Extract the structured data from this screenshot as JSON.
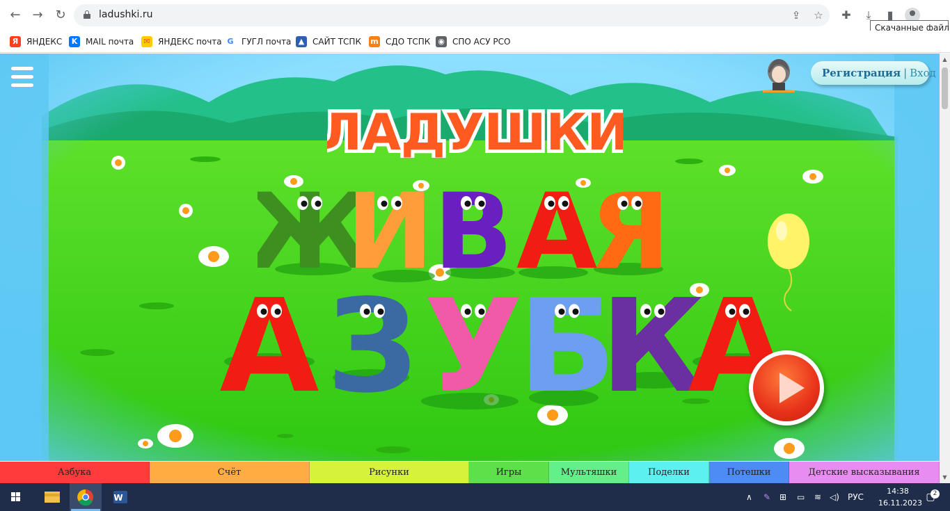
{
  "browser": {
    "url": "ladushki.ru",
    "tooltip": "Скачанные файлы",
    "bookmarks": [
      {
        "label": "ЯНДЕКС",
        "icon": "yandex-icon",
        "color": "#fc3f1d",
        "glyph": "Я"
      },
      {
        "label": "MAIL почта",
        "icon": "vk-icon",
        "color": "#0077ff",
        "glyph": "K"
      },
      {
        "label": "ЯНДЕКС почта",
        "icon": "mail-envelope-icon",
        "color": "#ffcc00",
        "glyph": "✉"
      },
      {
        "label": "ГУГЛ почта",
        "icon": "google-icon",
        "color": "#ffffff",
        "glyph": "G"
      },
      {
        "label": "САЙТ ТСПК",
        "icon": "tspk-icon",
        "color": "#2f5fb3",
        "glyph": "▲"
      },
      {
        "label": "СДО ТСПК",
        "icon": "moodle-icon",
        "color": "#f98012",
        "glyph": "m"
      },
      {
        "label": "СПО АСУ РСО",
        "icon": "globe-icon",
        "color": "#5f6368",
        "glyph": "◉"
      }
    ]
  },
  "page": {
    "auth": {
      "register": "Регистрация",
      "separator": "|",
      "login": "Вход"
    },
    "logo": "ЛАДУШКИ",
    "title_line1": [
      {
        "ch": "Ж",
        "color": "#3d8f1f"
      },
      {
        "ch": "И",
        "color": "#ff9d3b"
      },
      {
        "ch": "В",
        "color": "#6a1fbf"
      },
      {
        "ch": "А",
        "color": "#f21d12"
      },
      {
        "ch": "Я",
        "color": "#ff6a12"
      }
    ],
    "title_line2": [
      {
        "ch": "А",
        "color": "#f21d12"
      },
      {
        "ch": "З",
        "color": "#3b6aa3"
      },
      {
        "ch": "У",
        "color": "#f05aa8"
      },
      {
        "ch": "Б",
        "color": "#6d9ff0"
      },
      {
        "ch": "К",
        "color": "#6a2fa0"
      },
      {
        "ch": "А",
        "color": "#f21d12"
      }
    ],
    "colors": {
      "sky": "#5ec8f3",
      "grass": "#3ccf1c",
      "hills": "#1fbf7a",
      "balloon": "#fff36a"
    }
  },
  "categories": [
    {
      "label": "Азбука",
      "color": "#ff3b3b",
      "width": 215
    },
    {
      "label": "Счёт",
      "color": "#ffad42",
      "width": 230
    },
    {
      "label": "Рисунки",
      "color": "#d6f23a",
      "width": 229
    },
    {
      "label": "Игры",
      "color": "#5de04a",
      "width": 115
    },
    {
      "label": "Мультяшки",
      "color": "#63f08a",
      "width": 115
    },
    {
      "label": "Поделки",
      "color": "#5cf0f0",
      "width": 115
    },
    {
      "label": "Потешки",
      "color": "#4e8cf5",
      "width": 115
    },
    {
      "label": "Детские высказывания",
      "color": "#e98cf2",
      "width": 216
    }
  ],
  "taskbar": {
    "language": "РУС",
    "time": "14:38",
    "date": "16.11.2023",
    "notifications": "2"
  }
}
